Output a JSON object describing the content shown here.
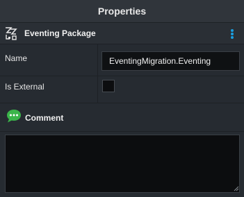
{
  "panel": {
    "title": "Properties"
  },
  "section": {
    "title": "Eventing Package",
    "icon": "eventing-package-icon",
    "menu_icon": "kebab-menu-icon",
    "accent_color": "#1a9fe0"
  },
  "properties": {
    "name": {
      "label": "Name",
      "value": "EventingMigration.Eventing"
    },
    "is_external": {
      "label": "Is External",
      "checked": false
    }
  },
  "comment": {
    "title": "Comment",
    "icon": "speech-bubble-icon",
    "icon_color": "#3bb54a",
    "value": ""
  }
}
